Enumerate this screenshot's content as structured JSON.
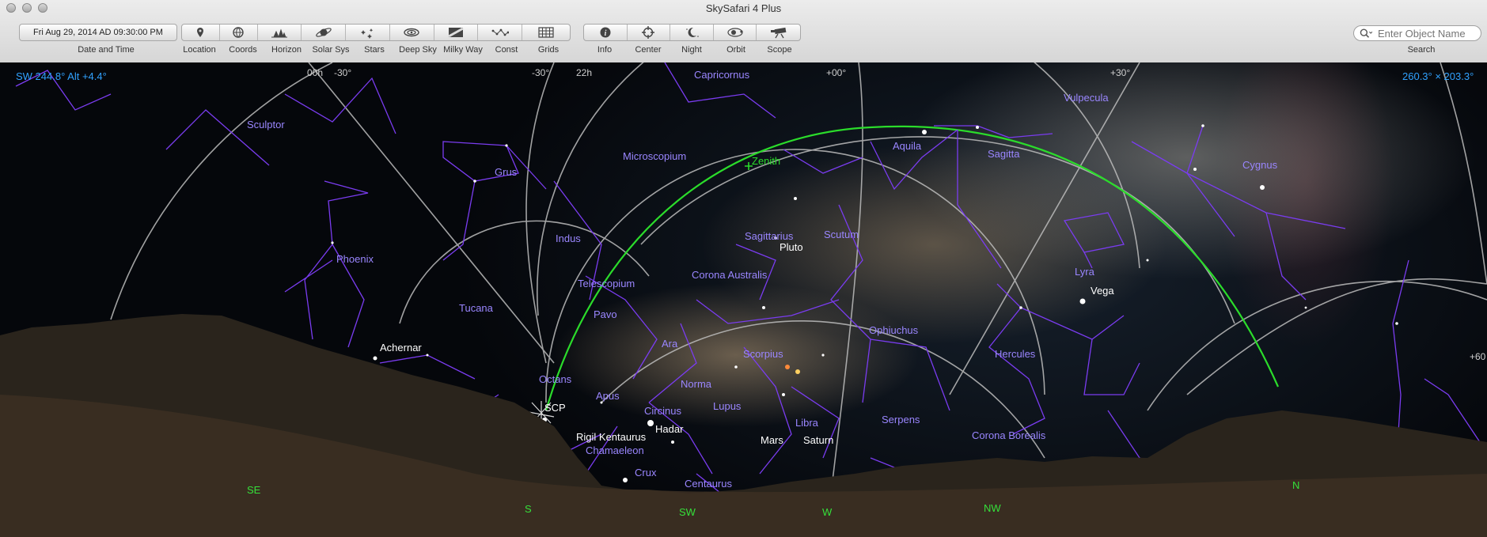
{
  "window": {
    "title": "SkySafari 4 Plus"
  },
  "toolbar": {
    "date_value": "Fri Aug 29, 2014 AD 09:30:00 PM",
    "labels": {
      "date_time": "Date and Time",
      "location": "Location",
      "coords": "Coords",
      "horizon": "Horizon",
      "solar_sys": "Solar Sys",
      "stars": "Stars",
      "deep_sky": "Deep Sky",
      "milky_way": "Milky Way",
      "const": "Const",
      "grids": "Grids",
      "info": "Info",
      "center": "Center",
      "night": "Night",
      "orbit": "Orbit",
      "scope": "Scope",
      "search": "Search"
    },
    "search_placeholder": "Enter Object Name",
    "icons": [
      "location-pin-icon",
      "coords-icon",
      "horizon-icon",
      "planet-icon",
      "stars-icon",
      "galaxy-icon",
      "milky-way-icon",
      "constellation-icon",
      "grid-icon",
      "info-icon",
      "crosshair-icon",
      "moon-icon",
      "orbit-icon",
      "telescope-icon",
      "magnifier-icon"
    ]
  },
  "sky": {
    "pointing": "SW 244.8° Alt +4.4°",
    "field_of_view": "260.3° × 203.3°",
    "constellations": [
      "Capricornus",
      "Vulpecula",
      "Sculptor",
      "Aquila",
      "Sagitta",
      "Cygnus",
      "Microscopium",
      "Zenith",
      "Grus",
      "Sagittarius",
      "Scutum",
      "Indus",
      "Phoenix",
      "Lyra",
      "Telescopium",
      "Corona Australis",
      "Tucana",
      "Pavo",
      "Ophiuchus",
      "Ara",
      "Scorpius",
      "Hercules",
      "Octans",
      "Apus",
      "Norma",
      "Circinus",
      "Lupus",
      "Libra",
      "Serpens",
      "Corona Borealis",
      "Chamaeleon",
      "Crux",
      "Centaurus"
    ],
    "stars_planets": [
      "Pluto",
      "Vega",
      "Achernar",
      "SCP",
      "Hadar",
      "Rigil Kentaurus",
      "Mars",
      "Saturn"
    ],
    "grid_labels": [
      "00h",
      "-30°",
      "-30°",
      "22h",
      "+00°",
      "+30°",
      "+60"
    ],
    "directions": [
      "SE",
      "S",
      "SW",
      "W",
      "NW",
      "N"
    ],
    "colors": {
      "constellation_lines": "#7a3cf0",
      "constellation_labels": "#9a86ff",
      "ecliptic_green": "#2bdc2b",
      "grid": "#bdbdbd",
      "hud_blue": "#31a2ff"
    }
  }
}
